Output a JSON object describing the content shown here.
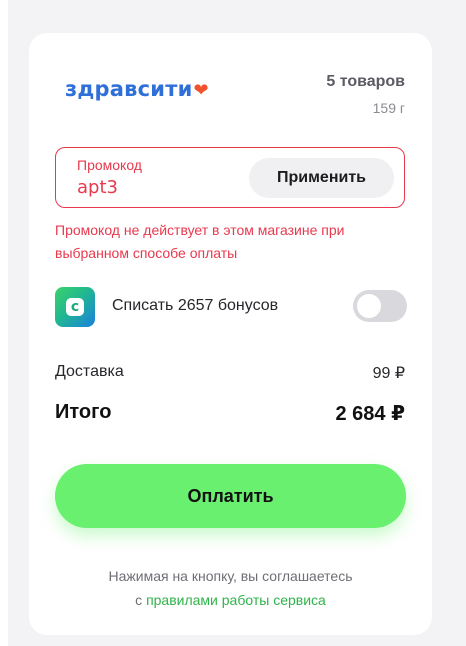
{
  "store": {
    "logo_text": "здравсити",
    "items_count": "5 товаров",
    "weight": "159 г"
  },
  "promo": {
    "label": "Промокод",
    "value": "apt3",
    "apply_label": "Применить",
    "error": "Промокод не действует в этом магазине при выбранном способе оплаты"
  },
  "bonus": {
    "label": "Списать 2657 бонусов",
    "icon_letter": "c",
    "toggle_on": false
  },
  "summary": {
    "delivery_label": "Доставка",
    "delivery_value": "99 ₽",
    "total_label": "Итого",
    "total_value": "2 684 ₽"
  },
  "pay": {
    "label": "Оплатить"
  },
  "legal": {
    "prefix_line1": "Нажимая на кнопку, вы соглашаетесь",
    "prefix_line2": "с",
    "link": "правилами работы сервиса"
  },
  "colors": {
    "accent_green": "#69f06f",
    "error_red": "#e8394d",
    "brand_blue": "#2f6fd8",
    "link_green": "#2fb34a"
  },
  "icons": [
    "heart-icon",
    "bonus-app-icon"
  ]
}
